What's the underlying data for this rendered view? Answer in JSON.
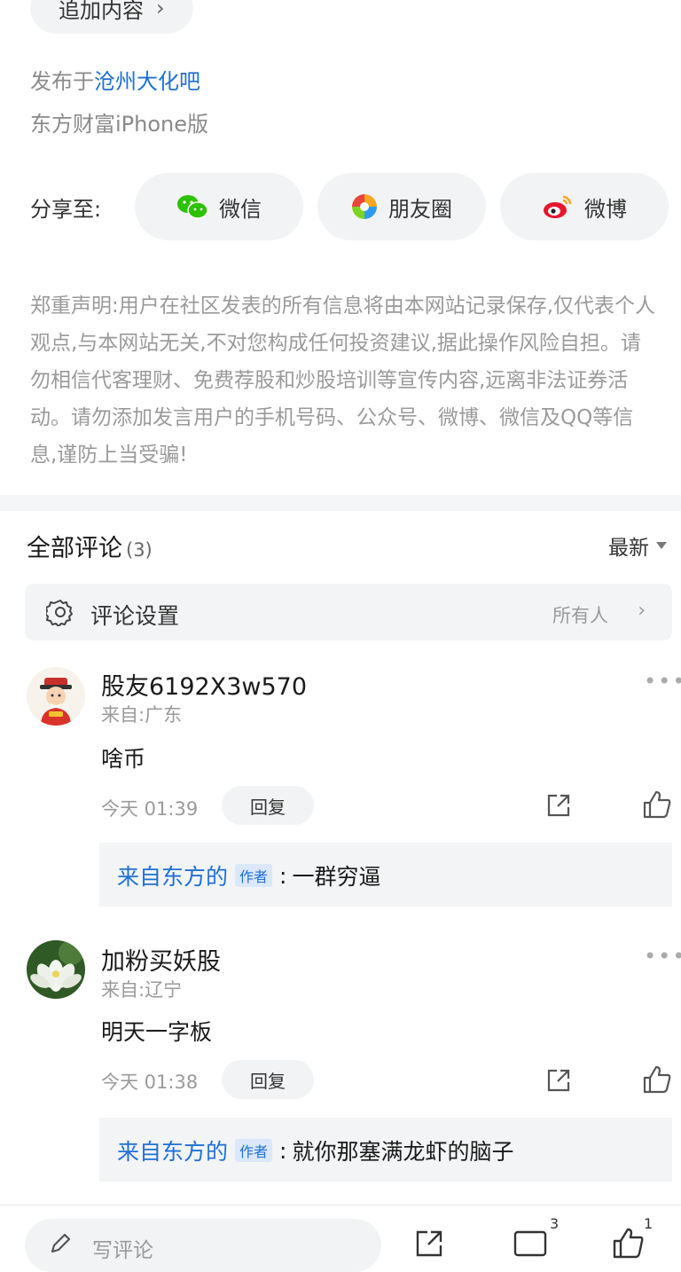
{
  "top": {
    "append_label": "追加内容",
    "published_prefix": "发布于",
    "published_bar": "沧州大化吧",
    "device": "东方财富iPhone版"
  },
  "share": {
    "label": "分享至:",
    "targets": [
      {
        "label": "微信",
        "icon": "wechat-icon",
        "color": "#2dc100"
      },
      {
        "label": "朋友圈",
        "icon": "moments-icon",
        "color": "#2c9bf0"
      },
      {
        "label": "微博",
        "icon": "weibo-icon",
        "color": "#e6162d"
      }
    ]
  },
  "disclaimer": "郑重声明:用户在社区发表的所有信息将由本网站记录保存,仅代表个人观点,与本网站无关,不对您构成任何投资建议,据此操作风险自担。请勿相信代客理财、免费荐股和炒股培训等宣传内容,远离非法证券活动。请勿添加发言用户的手机号码、公众号、微博、微信及QQ等信息,谨防上当受骗!",
  "comments": {
    "title": "全部评论",
    "count": "(3)",
    "sort_label": "最新",
    "settings_label": "评论设置",
    "settings_value": "所有人",
    "items": [
      {
        "user": "股友6192X3w570",
        "location": "来自:广东",
        "text": "啥币",
        "time": "今天 01:39",
        "reply_label": "回复",
        "sub_reply": {
          "user": "来自东方的",
          "tag": "作者",
          "sep": ":",
          "text": "一群穷逼"
        }
      },
      {
        "user": "加粉买妖股",
        "location": "来自:辽宁",
        "text": "明天一字板",
        "time": "今天 01:38",
        "reply_label": "回复",
        "sub_reply": {
          "user": "来自东方的",
          "tag": "作者",
          "sep": ":",
          "text": "就你那塞满龙虾的脑子"
        }
      }
    ]
  },
  "bottom_bar": {
    "write_placeholder": "写评论",
    "comment_count": "3",
    "like_count": "1"
  },
  "colors": {
    "link": "#1f6fd6",
    "muted": "#9a9a9a",
    "pill_bg": "#f2f3f5"
  }
}
